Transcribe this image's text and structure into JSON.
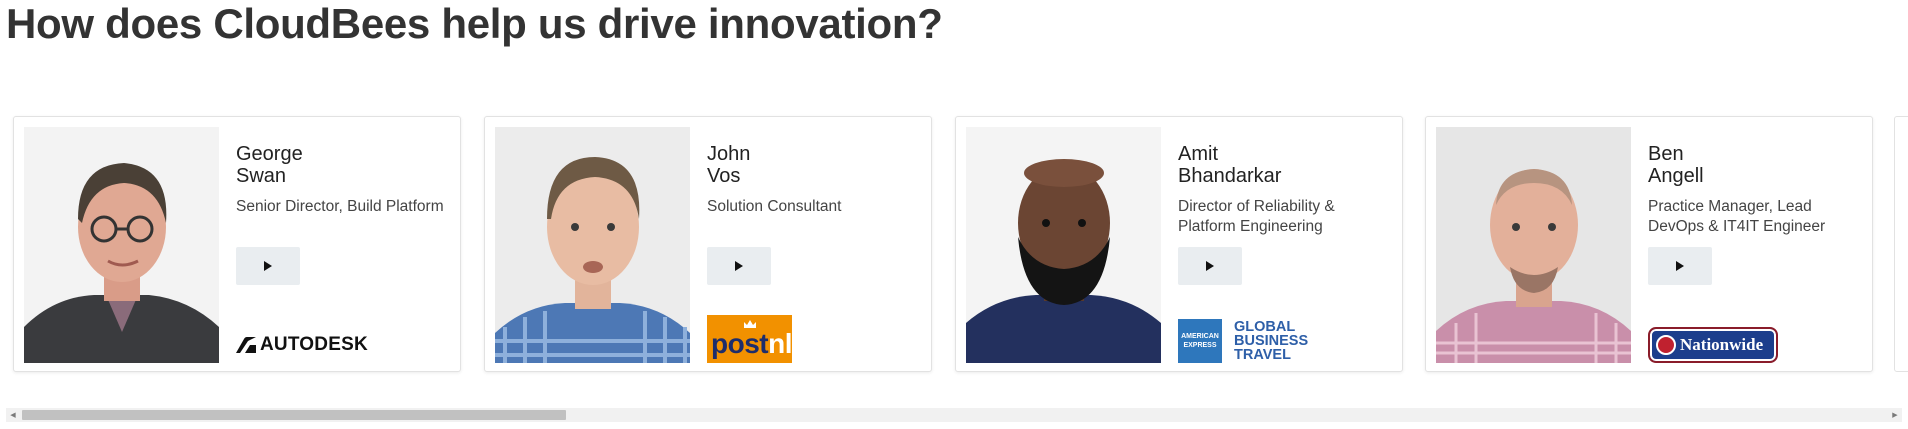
{
  "heading": "How does CloudBees help us drive innovation?",
  "cards": [
    {
      "first_name": "George",
      "last_name": "Swan",
      "role": "Senior Director, Build Platform",
      "company": "AUTODESK",
      "play_label": "▶"
    },
    {
      "first_name": "John",
      "last_name": "Vos",
      "role": "Solution Consultant",
      "company_primary": "post",
      "company_secondary": "nl",
      "play_label": "▶"
    },
    {
      "first_name": "Amit",
      "last_name": "Bhandarkar",
      "role": "Director of Reliability & Platform Engineering",
      "company_badge_top": "AMERICAN",
      "company_badge_bottom": "EXPRESS",
      "company_line1": "GLOBAL",
      "company_line2": "BUSINESS",
      "company_line3": "TRAVEL",
      "play_label": "▶"
    },
    {
      "first_name": "Ben",
      "last_name": "Angell",
      "role": "Practice Manager, Lead DevOps & IT4IT Engineer",
      "company": "Nationwide",
      "play_label": "▶"
    }
  ],
  "scrollbar": {
    "left_arrow": "◀",
    "right_arrow": "▶",
    "position_fraction": 0.0
  },
  "colors": {
    "play_button_bg": "#e9edf0",
    "postnl_orange": "#f29100",
    "amex_blue": "#2e77bc",
    "nationwide_blue": "#1c3e8c"
  }
}
